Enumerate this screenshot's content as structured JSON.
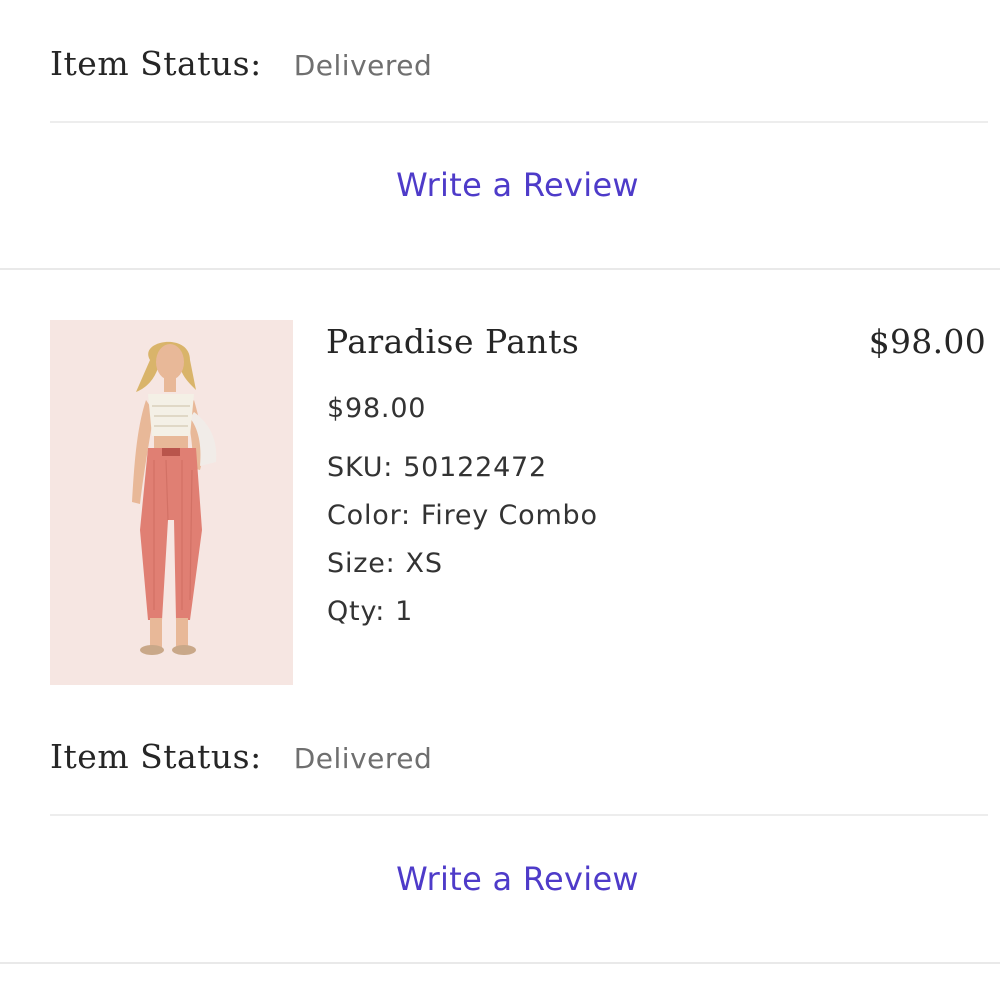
{
  "top_item": {
    "status_label": "Item Status:",
    "status_value": "Delivered",
    "review_link": "Write a Review"
  },
  "product": {
    "name": "Paradise Pants",
    "line_total": "$98.00",
    "unit_price": "$98.00",
    "sku_label": "SKU:",
    "sku": "50122472",
    "color_label": "Color:",
    "color": "Firey Combo",
    "size_label": "Size:",
    "size": "XS",
    "qty_label": "Qty:",
    "qty": "1",
    "status_label": "Item Status:",
    "status_value": "Delivered",
    "review_link": "Write a Review"
  },
  "colors": {
    "link": "#4e3bc9",
    "status_value": "#6f6f6f",
    "divider": "#ededed",
    "thumb_bg": "#f6e6e2",
    "pants": "#e07f73"
  }
}
